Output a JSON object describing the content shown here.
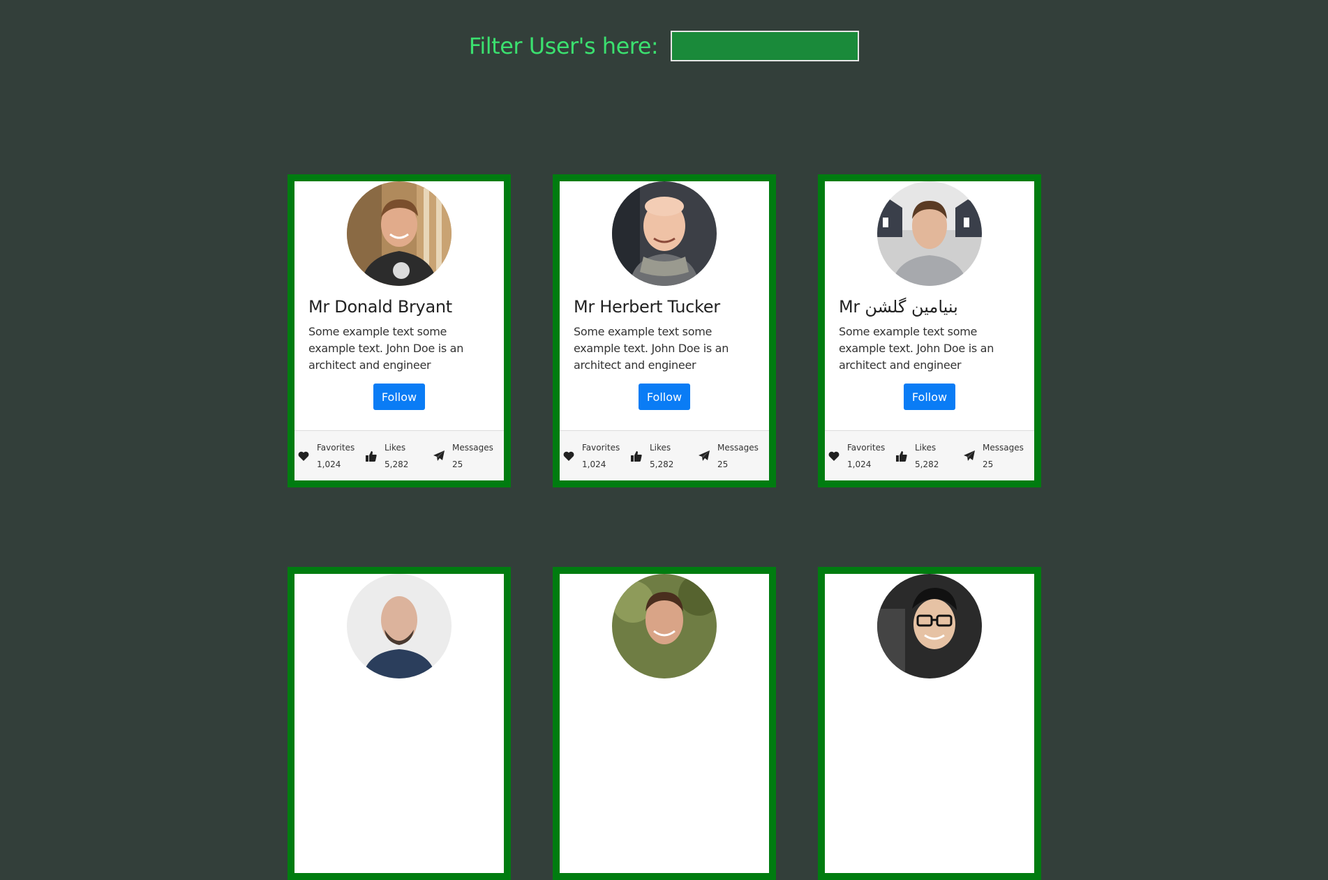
{
  "filter": {
    "label": "Filter User's here:",
    "value": "",
    "input_bg": "#1a8a3a",
    "label_color": "#3be06f"
  },
  "theme": {
    "background": "#333f3a",
    "card_border": "#007c10",
    "button_color": "#0a7cf5"
  },
  "stat_labels": {
    "favorites": "Favorites",
    "likes": "Likes",
    "messages": "Messages"
  },
  "cards": [
    {
      "name": "Mr Donald Bryant",
      "text": "Some example text some example text. John Doe is an architect and engineer",
      "button": "Follow",
      "favorites": "1,024",
      "likes": "5,282",
      "messages": "25",
      "avatar": "avatar-smiling-man-dark-shirt"
    },
    {
      "name": "Mr Herbert Tucker",
      "text": "Some example text some example text. John Doe is an architect and engineer",
      "button": "Follow",
      "favorites": "1,024",
      "likes": "5,282",
      "messages": "25",
      "avatar": "avatar-bald-man-scarf"
    },
    {
      "name": "Mr بنیامین گلشن",
      "text": "Some example text some example text. John Doe is an architect and engineer",
      "button": "Follow",
      "favorites": "1,024",
      "likes": "5,282",
      "messages": "25",
      "avatar": "avatar-young-man-grey-shirt"
    },
    {
      "name": "",
      "text": "",
      "button": "",
      "favorites": "",
      "likes": "",
      "messages": "",
      "avatar": "avatar-bald-bearded-man"
    },
    {
      "name": "",
      "text": "",
      "button": "",
      "favorites": "",
      "likes": "",
      "messages": "",
      "avatar": "avatar-smiling-man-outdoors"
    },
    {
      "name": "",
      "text": "",
      "button": "",
      "favorites": "",
      "likes": "",
      "messages": "",
      "avatar": "avatar-man-glasses"
    }
  ]
}
